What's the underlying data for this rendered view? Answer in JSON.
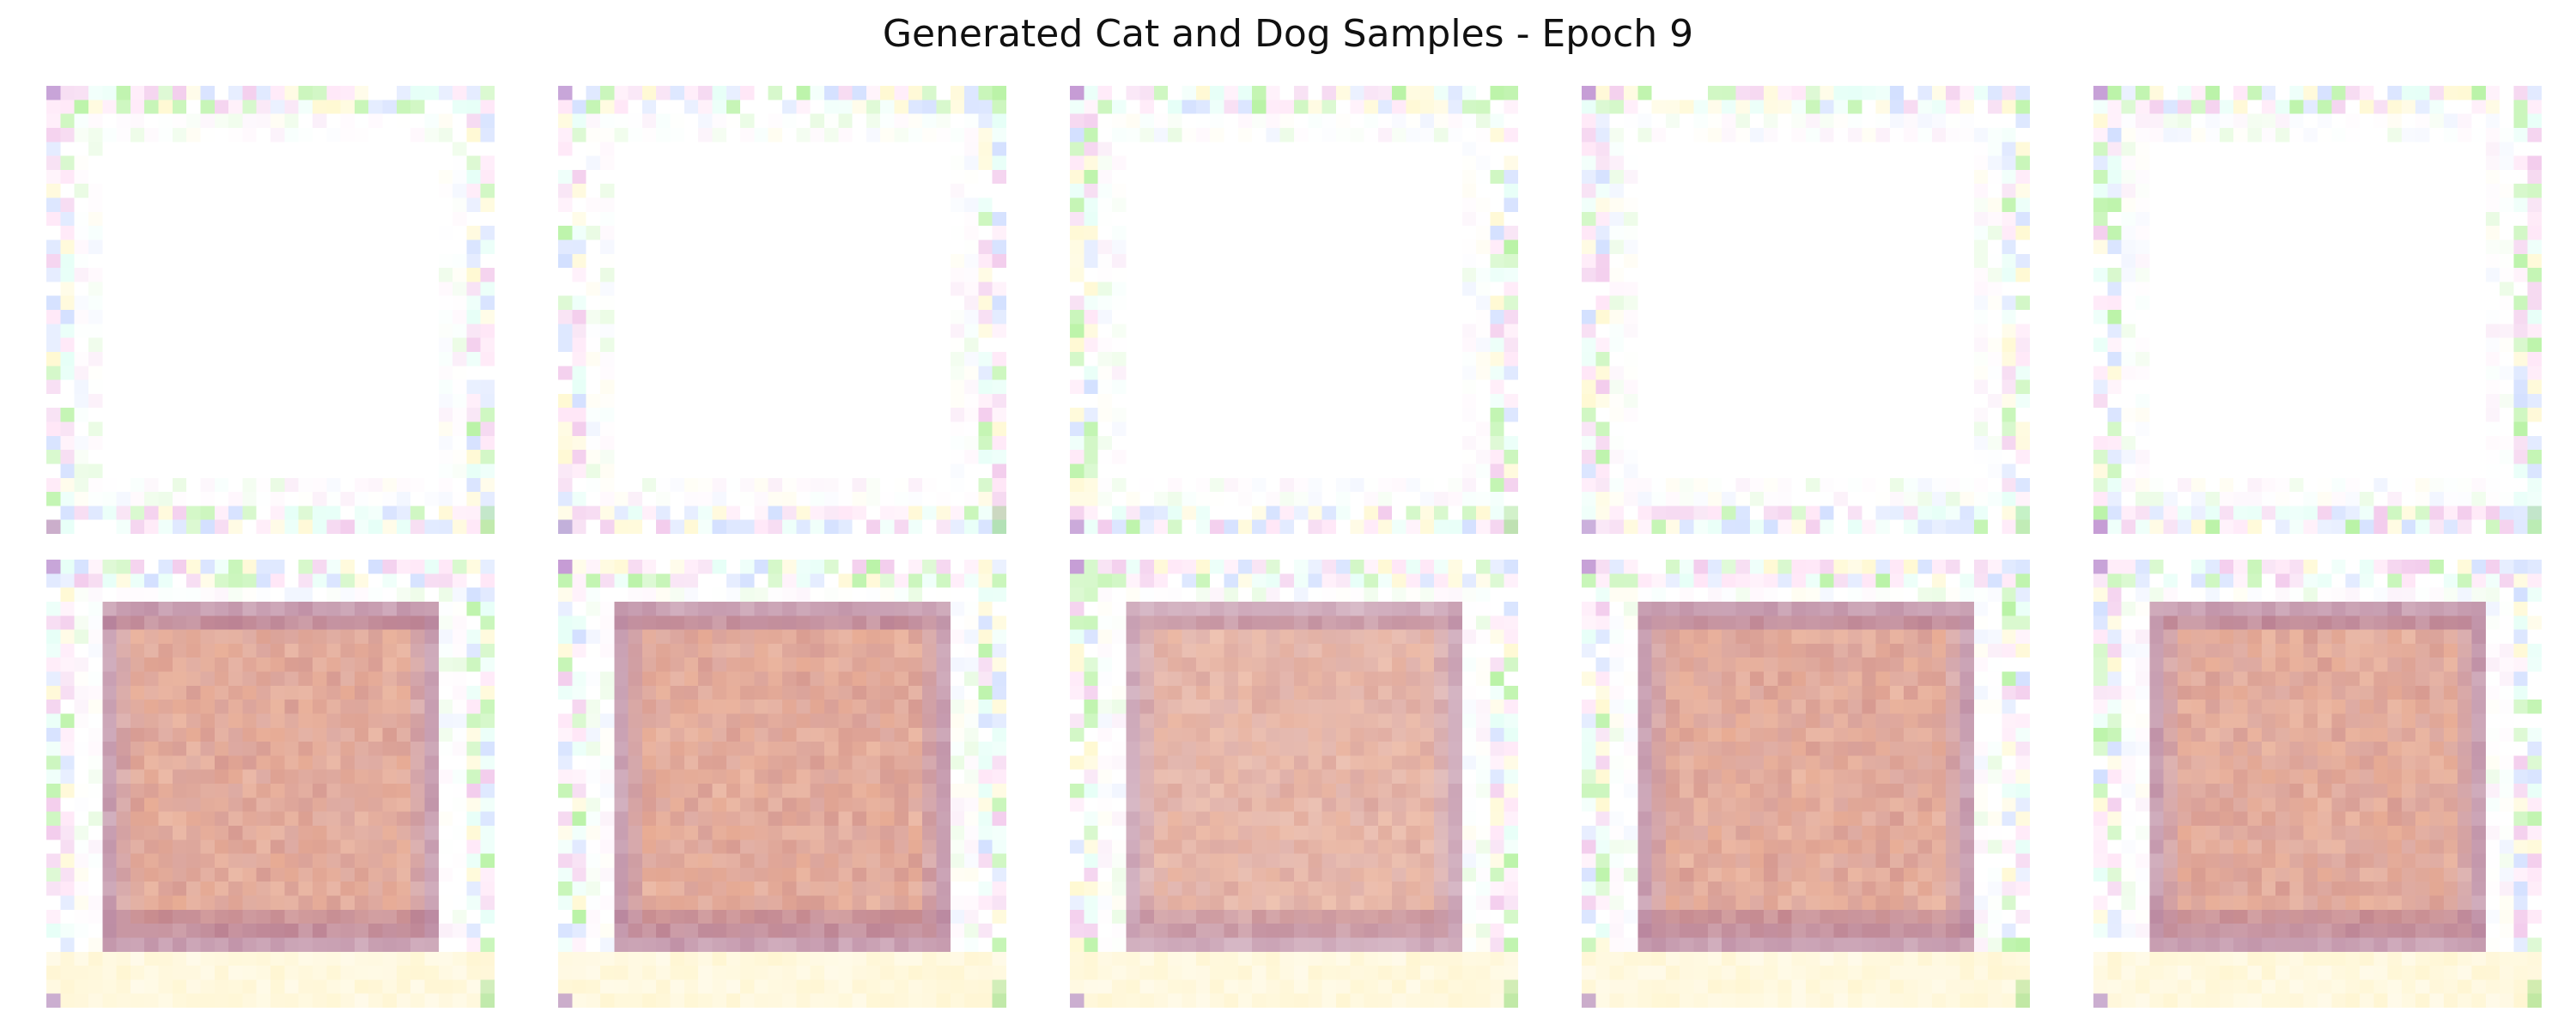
{
  "figure": {
    "title": "Generated Cat and Dog Samples - Epoch 9"
  },
  "samples": {
    "rows": [
      {
        "kind": "pale",
        "count": 5
      },
      {
        "kind": "warm",
        "count": 5
      }
    ],
    "colors": {
      "frame_noise": [
        "#ffe0f5",
        "#e0fff5",
        "#fff7c8",
        "#c8d8ff",
        "#a8f090",
        "#f0c0e8",
        "#ffffff"
      ],
      "corner_green": "#8fdc7a",
      "corner_purple": "#a070c0",
      "warm_center": "#e8ac94",
      "warm_edge": "#c9a0b2",
      "warm_dark": "#a86a88"
    }
  }
}
